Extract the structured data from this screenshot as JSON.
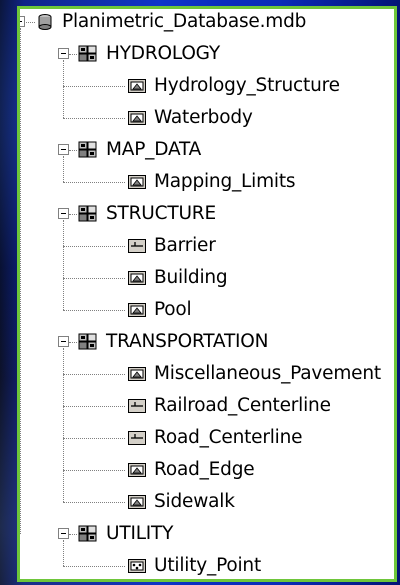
{
  "tree": {
    "root": {
      "label": "Planimetric_Database.mdb",
      "icon": "database-cylinder-icon"
    },
    "datasets": [
      {
        "label": "HYDROLOGY",
        "icon": "feature-dataset-icon",
        "children": [
          {
            "label": "Hydrology_Structure",
            "icon": "polygon-feature-class-icon"
          },
          {
            "label": "Waterbody",
            "icon": "polygon-feature-class-icon"
          }
        ]
      },
      {
        "label": "MAP_DATA",
        "icon": "feature-dataset-icon",
        "children": [
          {
            "label": "Mapping_Limits",
            "icon": "polygon-feature-class-icon"
          }
        ]
      },
      {
        "label": "STRUCTURE",
        "icon": "feature-dataset-icon",
        "children": [
          {
            "label": "Barrier",
            "icon": "line-feature-class-icon"
          },
          {
            "label": "Building",
            "icon": "polygon-feature-class-icon"
          },
          {
            "label": "Pool",
            "icon": "polygon-feature-class-icon"
          }
        ]
      },
      {
        "label": "TRANSPORTATION",
        "icon": "feature-dataset-icon",
        "children": [
          {
            "label": "Miscellaneous_Pavement",
            "icon": "polygon-feature-class-icon"
          },
          {
            "label": "Railroad_Centerline",
            "icon": "line-feature-class-icon"
          },
          {
            "label": "Road_Centerline",
            "icon": "line-feature-class-icon"
          },
          {
            "label": "Road_Edge",
            "icon": "polygon-feature-class-icon"
          },
          {
            "label": "Sidewalk",
            "icon": "polygon-feature-class-icon"
          }
        ]
      },
      {
        "label": "UTILITY",
        "icon": "feature-dataset-icon",
        "children": [
          {
            "label": "Utility_Point",
            "icon": "point-feature-class-icon"
          }
        ]
      }
    ]
  },
  "colors": {
    "panel_border": "#6ec63a",
    "background": "#0a2fc4"
  }
}
